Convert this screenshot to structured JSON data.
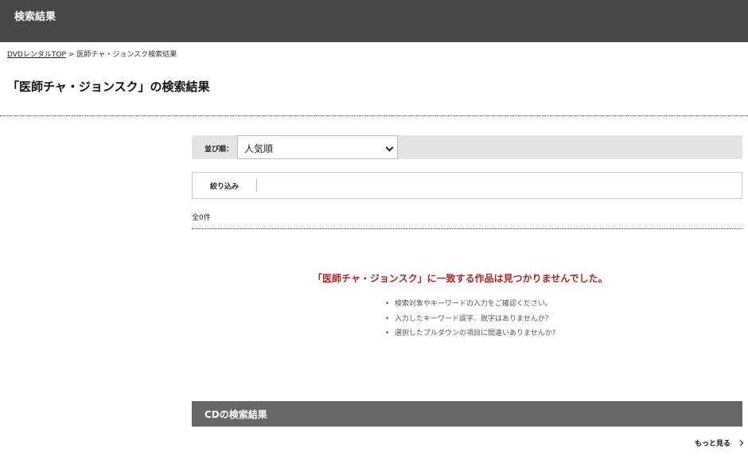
{
  "header": {
    "title": "検索結果"
  },
  "breadcrumb": {
    "home": "DVDレンタルTOP",
    "separator": ">",
    "current": "医師チャ・ジョンスク検索結果"
  },
  "page": {
    "title": "「医師チャ・ジョンスク」の検索結果"
  },
  "sort": {
    "label": "並び順：",
    "selected": "人気順"
  },
  "filter": {
    "label": "絞り込み"
  },
  "results": {
    "count_text": "全0件",
    "no_result_message": "「医師チャ・ジョンスク」に一致する作品は見つかりませんでした。",
    "tips": [
      "検索対象やキーワードの入力をご確認ください。",
      "入力したキーワード誤字、脱字はありませんか？",
      "選択したプルダウンの項目に間違いありませんか?"
    ]
  },
  "cd_section": {
    "title": "CDの検索結果",
    "more_label": "もっと見る"
  }
}
